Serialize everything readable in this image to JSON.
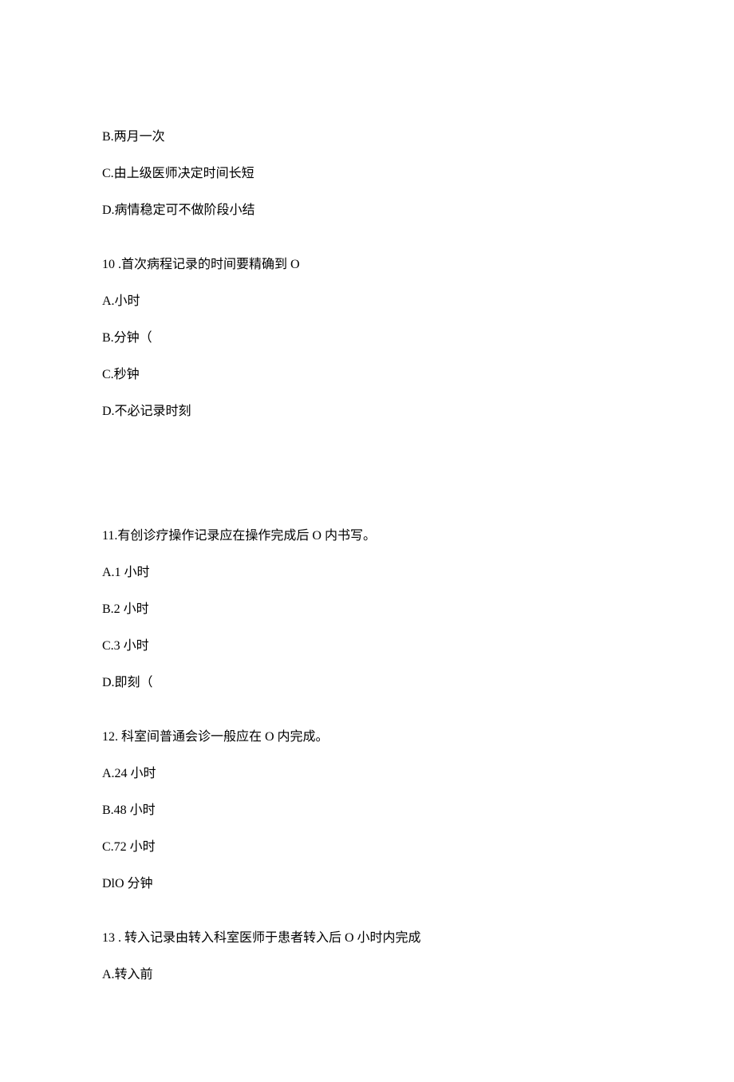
{
  "lines": {
    "l1": "B.两月一次",
    "l2": "C.由上级医师决定时间长短",
    "l3": "D.病情稳定可不做阶段小结",
    "l4": "10 .首次病程记录的时间要精确到 O",
    "l5": "A.小时",
    "l6": "B.分钟（",
    "l7": "C.秒钟",
    "l8": "D.不必记录时刻",
    "l9": "11.有创诊疗操作记录应在操作完成后 O 内书写。",
    "l10": "A.1 小时",
    "l11": "B.2 小时",
    "l12": "C.3 小时",
    "l13": "D.即刻（",
    "l14": "12. 科室间普通会诊一般应在 O 内完成。",
    "l15": "A.24 小时",
    "l16": "B.48 小时",
    "l17": "C.72 小时",
    "l18": "DlO 分钟",
    "l19": "13 . 转入记录由转入科室医师于患者转入后 O 小时内完成",
    "l20": "A.转入前"
  }
}
